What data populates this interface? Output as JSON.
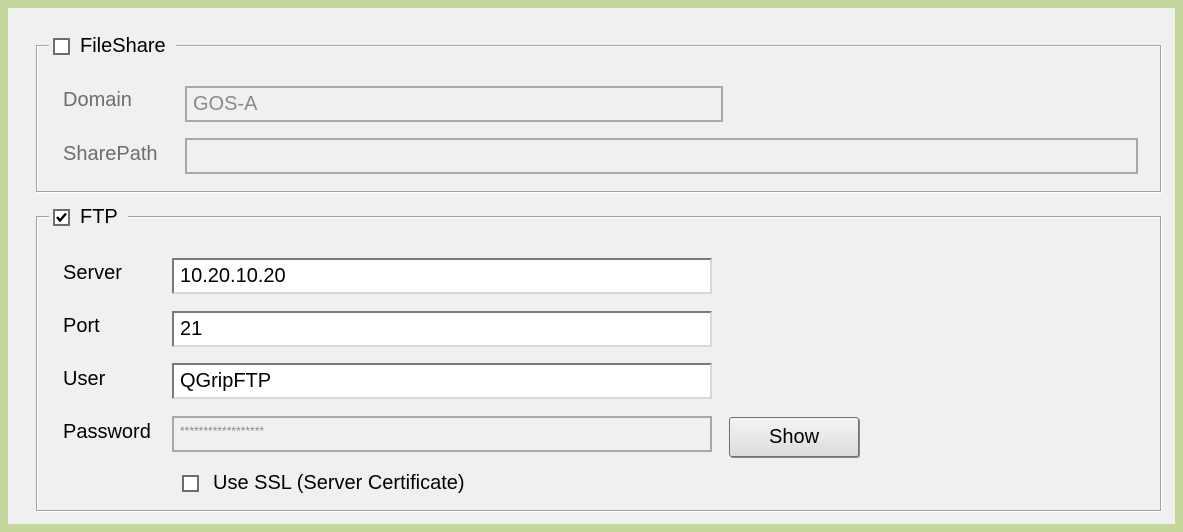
{
  "fileshare": {
    "title": "FileShare",
    "checked": false,
    "domain_label": "Domain",
    "domain_value": "GOS-A",
    "sharepath_label": "SharePath",
    "sharepath_value": ""
  },
  "ftp": {
    "title": "FTP",
    "checked": true,
    "server_label": "Server",
    "server_value": "10.20.10.20",
    "port_label": "Port",
    "port_value": "21",
    "user_label": "User",
    "user_value": "QGripFTP",
    "password_label": "Password",
    "password_value": "******************",
    "show_button": "Show",
    "ssl_label": "Use SSL (Server Certificate)",
    "ssl_checked": false
  }
}
